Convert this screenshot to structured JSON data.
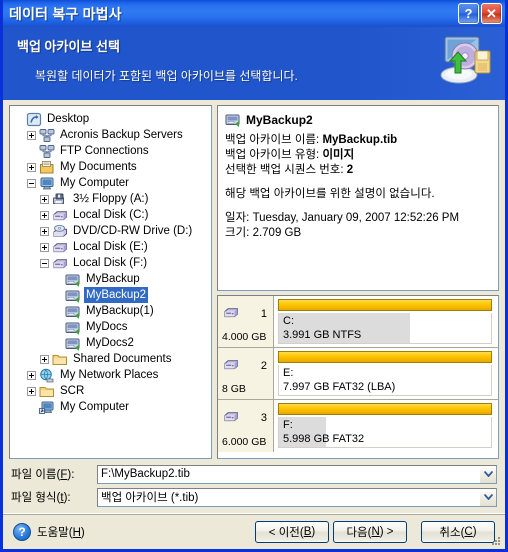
{
  "window": {
    "title": "데이터 복구 마법사",
    "help_button": "?",
    "close_button": "✕"
  },
  "banner": {
    "title": "백업 아카이브 선택",
    "subtitle": "복원할 데이터가 포함된 백업 아카이브를 선택합니다.",
    "icon": "restore-computer-icon"
  },
  "tree": {
    "items": [
      {
        "label": "Desktop",
        "indent": 0,
        "expander": "none",
        "icon": "desktop-icon",
        "selected": false
      },
      {
        "label": "Acronis Backup Servers",
        "indent": 1,
        "expander": "plus",
        "icon": "network-icon",
        "selected": false
      },
      {
        "label": "FTP Connections",
        "indent": 1,
        "expander": "none",
        "icon": "network-icon",
        "selected": false
      },
      {
        "label": "My Documents",
        "indent": 1,
        "expander": "plus",
        "icon": "documents-icon",
        "selected": false
      },
      {
        "label": "My Computer",
        "indent": 1,
        "expander": "minus",
        "icon": "computer-icon",
        "selected": false
      },
      {
        "label": "3½ Floppy (A:)",
        "indent": 2,
        "expander": "plus",
        "icon": "floppy-icon",
        "selected": false
      },
      {
        "label": "Local Disk (C:)",
        "indent": 2,
        "expander": "plus",
        "icon": "harddisk-icon",
        "selected": false
      },
      {
        "label": "DVD/CD-RW Drive (D:)",
        "indent": 2,
        "expander": "plus",
        "icon": "cdrom-icon",
        "selected": false
      },
      {
        "label": "Local Disk (E:)",
        "indent": 2,
        "expander": "plus",
        "icon": "harddisk-icon",
        "selected": false
      },
      {
        "label": "Local Disk (F:)",
        "indent": 2,
        "expander": "minus",
        "icon": "harddisk-icon",
        "selected": false
      },
      {
        "label": "MyBackup",
        "indent": 3,
        "expander": "none",
        "icon": "archive-icon",
        "selected": false
      },
      {
        "label": "MyBackup2",
        "indent": 3,
        "expander": "none",
        "icon": "archive-icon",
        "selected": true
      },
      {
        "label": "MyBackup(1)",
        "indent": 3,
        "expander": "none",
        "icon": "archive-icon",
        "selected": false
      },
      {
        "label": "MyDocs",
        "indent": 3,
        "expander": "none",
        "icon": "archive-icon",
        "selected": false
      },
      {
        "label": "MyDocs2",
        "indent": 3,
        "expander": "none",
        "icon": "archive-icon",
        "selected": false
      },
      {
        "label": "Shared Documents",
        "indent": 2,
        "expander": "plus",
        "icon": "folder-icon",
        "selected": false
      },
      {
        "label": "My Network Places",
        "indent": 1,
        "expander": "plus",
        "icon": "network-places-icon",
        "selected": false
      },
      {
        "label": "SCR",
        "indent": 1,
        "expander": "plus",
        "icon": "folder-icon",
        "selected": false
      },
      {
        "label": "My Computer",
        "indent": 1,
        "expander": "none",
        "icon": "computer-alt-icon",
        "selected": false
      }
    ]
  },
  "info": {
    "heading": "MyBackup2",
    "heading_icon": "archive-icon",
    "archive_name_label": "백업 아카이브 이름:",
    "archive_name_value": "MyBackup.tib",
    "archive_type_label": "백업 아카이브 유형:",
    "archive_type_value": "이미지",
    "sequence_label": "선택한 백업 시퀀스 번호:",
    "sequence_value": "2",
    "comment": "해당 백업 아카이브를 위한 설명이 없습니다.",
    "date_label": "일자:",
    "date_value": "Tuesday, January 09, 2007 12:52:26 PM",
    "size_label": "크기:",
    "size_value": "2.709 GB"
  },
  "partitions": [
    {
      "disk_icon": "harddisk-icon",
      "number": "1",
      "disk_size": "4.000 GB",
      "letter": "C:",
      "detail": "3.991 GB  NTFS",
      "used_percent": 62
    },
    {
      "disk_icon": "harddisk-icon",
      "number": "2",
      "disk_size": "8 GB",
      "letter": "E:",
      "detail": "7.997 GB  FAT32 (LBA)",
      "used_percent": 0
    },
    {
      "disk_icon": "harddisk-icon",
      "number": "3",
      "disk_size": "6.000 GB",
      "letter": "F:",
      "detail": "5.998 GB  FAT32",
      "used_percent": 22
    }
  ],
  "fields": {
    "filename_label_pre": "파일 이름(",
    "filename_label_key": "F",
    "filename_label_post": "):",
    "filename_value": "F:\\MyBackup2.tib",
    "filetype_label_pre": "파일 형식(",
    "filetype_label_key": "t",
    "filetype_label_post": "):",
    "filetype_value": "백업 아카이브 (*.tib)"
  },
  "footer": {
    "help_label_pre": "도움말(",
    "help_label_key": "H",
    "help_label_post": ")",
    "back_pre": "< 이전(",
    "back_key": "B",
    "back_post": ")",
    "next_pre": "다음(",
    "next_key": "N",
    "next_post": ") >",
    "cancel_pre": "취소(",
    "cancel_key": "C",
    "cancel_post": ")"
  },
  "colors": {
    "titlebar_blue": "#2f79f2",
    "banner_blue": "#2155cd",
    "selection_blue": "#316ac5",
    "partition_bar_yellow": "#ffc800",
    "dialog_face": "#ece9d8"
  }
}
